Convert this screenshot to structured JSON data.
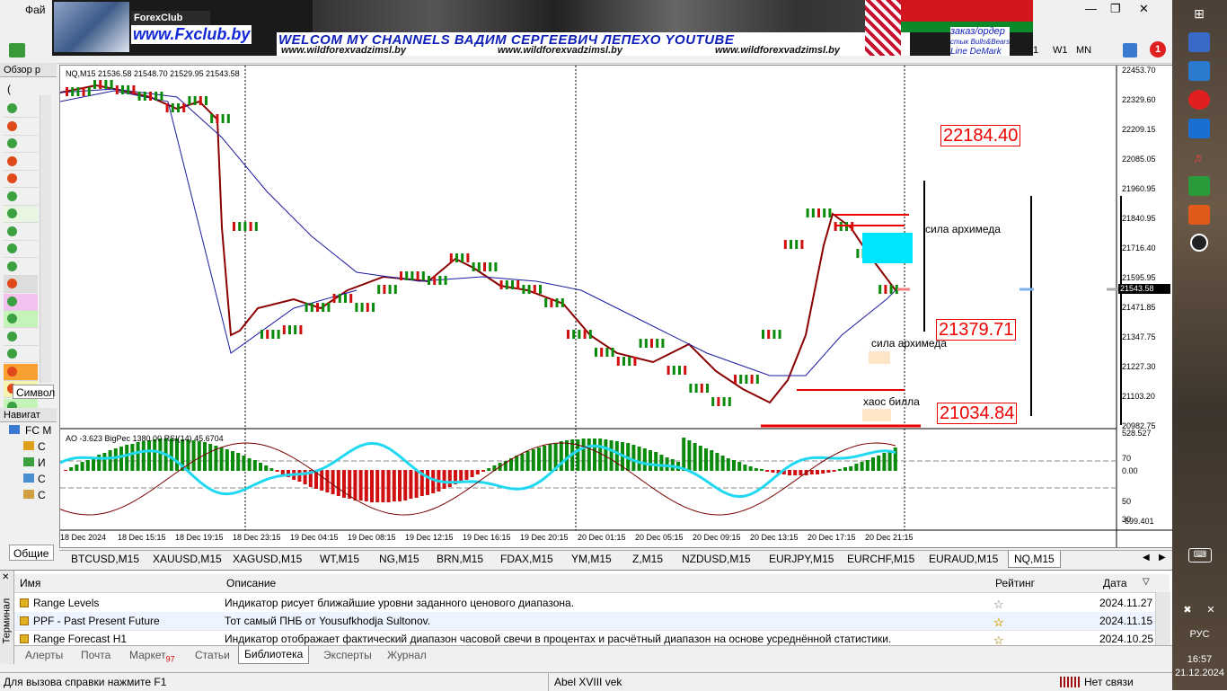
{
  "menu": {
    "file_label": "Фай"
  },
  "banner": {
    "brand": "ForexClub",
    "site": "www.Fxclub.by",
    "title": "WELCOM MY CHANNELS ВАДИМ СЕРГЕЕВИЧ ЛЕПЕХО YOUTUBE",
    "sub1": "www.wildforexvadzimsl.by",
    "sub2": "www.wildforexvadzimsl.by",
    "sub3": "www.wildforexvadzimsl.by",
    "order1": "заказ/ордер",
    "order2": "стык Bulls&Bears",
    "order3": "Line DeMark"
  },
  "toolbar": {
    "tf1": "1",
    "tf_w1": "W1",
    "tf_mn": "MN",
    "alert_count": "1"
  },
  "left_panel": {
    "market_watch": "Обзор р",
    "symbol_tab": "Символ",
    "navigator": "Навигат",
    "nav_root": "FC M",
    "nav_item1": "C",
    "nav_item2": "И",
    "nav_item3": "C",
    "nav_item4": "C",
    "general_tab": "Общие",
    "arrow_glyph": "("
  },
  "chart": {
    "header": "NQ,M15  21536.58 21548.70 21529.95 21543.58",
    "sub_header": "AO -3.623  BigPec 1380.00  RSI(14) 45.6704",
    "current_price": "21543.58",
    "price_ticks": [
      "22453.70",
      "22329.60",
      "22209.15",
      "22085.05",
      "21960.95",
      "21840.95",
      "21716.40",
      "21595.95",
      "21471.85",
      "21347.75",
      "21227.30",
      "21103.20",
      "20982.75"
    ],
    "ind_ticks": [
      "528.527",
      "70",
      "0.00",
      "50",
      "30",
      "-699.401"
    ],
    "time_ticks": [
      "18 Dec 2024",
      "18 Dec 15:15",
      "18 Dec 19:15",
      "18 Dec 23:15",
      "19 Dec 04:15",
      "19 Dec 08:15",
      "19 Dec 12:15",
      "19 Dec 16:15",
      "19 Dec 20:15",
      "20 Dec 01:15",
      "20 Dec 05:15",
      "20 Dec 09:15",
      "20 Dec 13:15",
      "20 Dec 17:15",
      "20 Dec 21:15"
    ],
    "level_high": "22184.40",
    "level_mid": "21379.71",
    "level_low": "21034.84",
    "annot_sila1": "сила архимеда",
    "annot_sila2": "сила архимеда",
    "annot_chaos": "хаос билла"
  },
  "symbol_tabs": [
    "BTCUSD,M15",
    "XAUUSD,M15",
    "XAGUSD,M15",
    "WT,M15",
    "NG,M15",
    "BRN,M15",
    "FDAX,M15",
    "YM,M15",
    "Z,M15",
    "NZDUSD,M15",
    "EURJPY,M15",
    "EURCHF,M15",
    "EURAUD,M15",
    "NQ,M15"
  ],
  "terminal": {
    "side_label": "Терминал",
    "col_name": "Имя",
    "col_desc": "Описание",
    "col_rating": "Рейтинг",
    "col_date": "Дата",
    "rows": [
      {
        "name": "Range Levels",
        "desc": "Индикатор рисует ближайшие уровни заданного ценового диапазона.",
        "date": "2024.11.27",
        "stars": 0
      },
      {
        "name": "PPF - Past Present Future",
        "desc": "Тот самый ПНБ от Yousufkhodja Sultonov.",
        "date": "2024.11.15",
        "stars": 5
      },
      {
        "name": "Range Forecast H1",
        "desc": "Индикатор отображает фактический диапазон часовой свечи в процентах и расчётный диапазон на основе усреднённой статистики.",
        "date": "2024.10.25",
        "stars": 4
      }
    ],
    "tabs": {
      "alerts": "Алерты",
      "mail": "Почта",
      "market": "Маркет",
      "market_badge": "97",
      "articles": "Статьи",
      "library": "Библиотека",
      "experts": "Эксперты",
      "journal": "Журнал"
    }
  },
  "status": {
    "help": "Для вызова справки нажмите F1",
    "profile": "Abel XVIII vek",
    "connection": "Нет связи"
  },
  "taskbar": {
    "lang": "РУС",
    "time": "16:57",
    "date": "21.12.2024"
  }
}
